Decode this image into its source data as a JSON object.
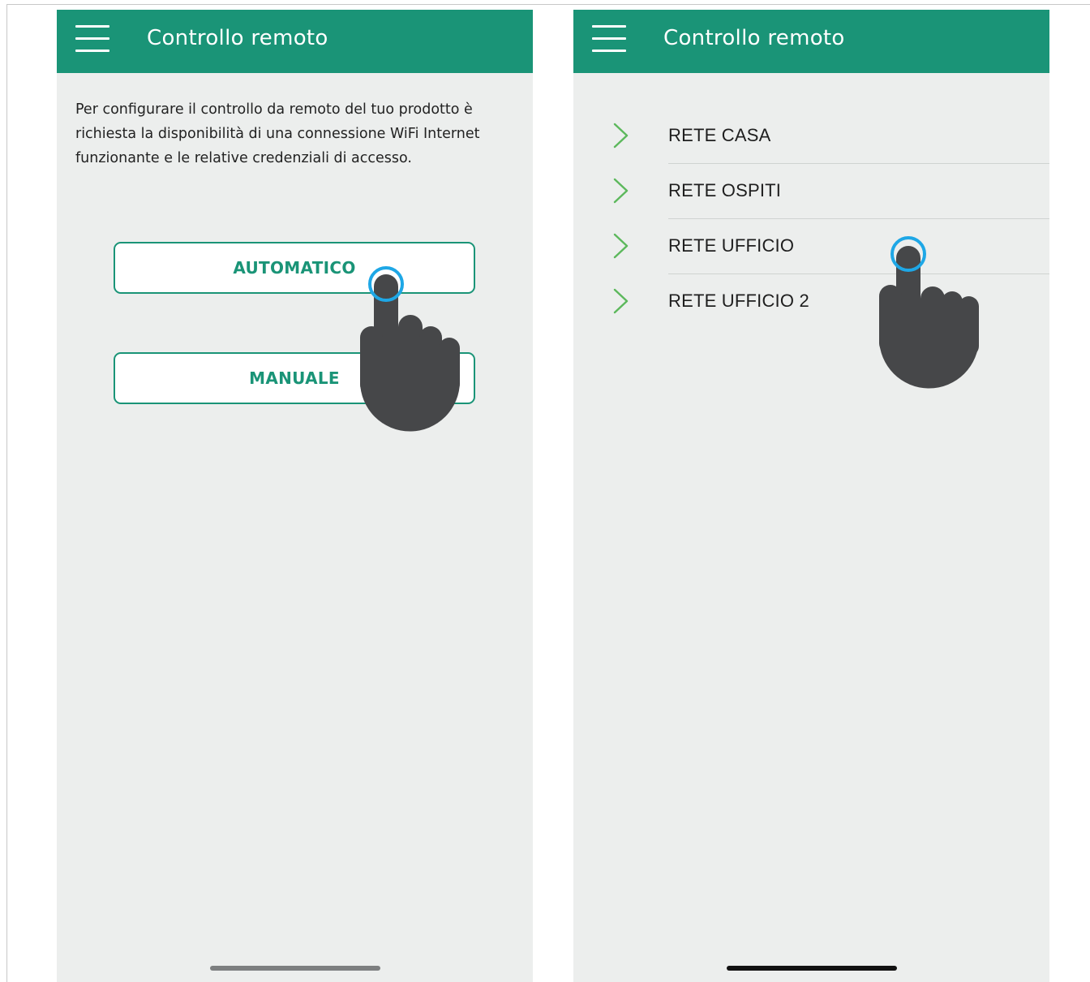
{
  "screens": [
    {
      "title": "Controllo remoto",
      "intro": "Per configurare il controllo da remoto del tuo prodotto è richiesta la disponibilità di una connessione WiFi Internet funzionante e le relative credenziali di accesso.",
      "buttons": [
        {
          "label": "AUTOMATICO"
        },
        {
          "label": "MANUALE"
        }
      ]
    },
    {
      "title": "Controllo remoto",
      "networks": [
        {
          "label": "RETE CASA"
        },
        {
          "label": "RETE OSPITI"
        },
        {
          "label": "RETE UFFICIO"
        },
        {
          "label": "RETE UFFICIO 2"
        }
      ]
    }
  ],
  "colors": {
    "app_bar": "#1a9477",
    "screen_background": "#eceeed",
    "button_text": "#1a9477",
    "chevron": "#5cb85c",
    "tap_ring": "#1ea7e6",
    "hand": "#464749"
  },
  "icons": {
    "menu": "hamburger-menu-icon",
    "chevron": "chevron-right-icon",
    "tap_gesture": "tap-hand-icon"
  }
}
